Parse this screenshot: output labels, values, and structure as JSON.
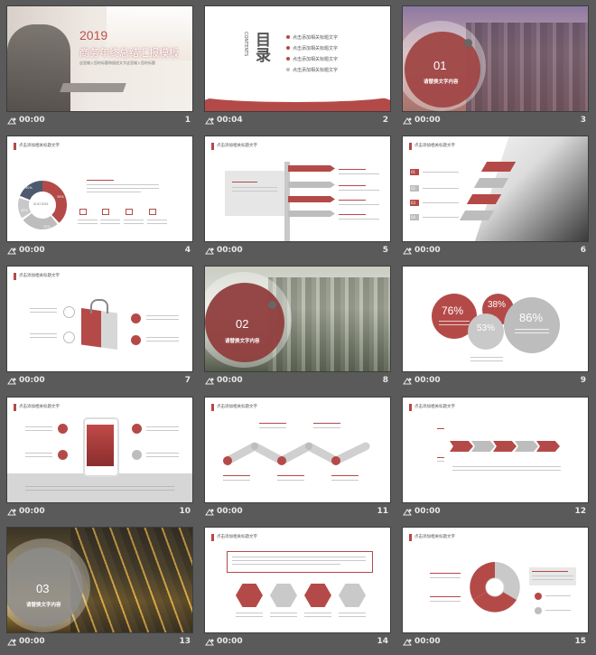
{
  "colors": {
    "accent": "#b44a48",
    "gray": "#bdbdbd",
    "dark": "#5a5a5a",
    "bg": "#5a5a5a"
  },
  "slides": [
    {
      "time": "00:00",
      "number": "1",
      "year": "2019",
      "title": "商务年终总结汇报模板",
      "subtitle": "这里输入您的标题和描述文字这里输入您的标题"
    },
    {
      "time": "00:04",
      "number": "2",
      "heading": "目录",
      "heading_en": "CONTENTS",
      "items": [
        "点击添加相关标题文字",
        "点击添加相关标题文字",
        "点击添加相关标题文字",
        "点击添加相关标题文字"
      ]
    },
    {
      "time": "00:00",
      "number": "3",
      "section_num": "01",
      "section_title": "请替换文字内容"
    },
    {
      "time": "00:00",
      "number": "4",
      "header": "点击添加相关标题文字",
      "center_label": "SUCCESS",
      "pct_a": "35%",
      "pct_b": "25%",
      "pct_c": "40%",
      "pct_d": "30%"
    },
    {
      "time": "00:00",
      "number": "5",
      "header": "点击添加相关标题文字"
    },
    {
      "time": "00:00",
      "number": "6",
      "header": "点击添加相关标题文字",
      "items": [
        "01",
        "02",
        "03",
        "04"
      ]
    },
    {
      "time": "00:00",
      "number": "7",
      "header": "点击添加相关标题文字"
    },
    {
      "time": "00:00",
      "number": "8",
      "section_num": "02",
      "section_title": "请替换文字内容"
    },
    {
      "time": "00:00",
      "number": "9",
      "stats": [
        "76%",
        "38%",
        "53%",
        "86%"
      ]
    },
    {
      "time": "00:00",
      "number": "10",
      "header": "点击添加相关标题文字"
    },
    {
      "time": "00:00",
      "number": "11",
      "header": "点击添加相关标题文字"
    },
    {
      "time": "00:00",
      "number": "12",
      "header": "点击添加相关标题文字"
    },
    {
      "time": "00:00",
      "number": "13",
      "section_num": "03",
      "section_title": "请替换文字内容"
    },
    {
      "time": "00:00",
      "number": "14",
      "header": "点击添加相关标题文字"
    },
    {
      "time": "00:00",
      "number": "15",
      "header": "点击添加相关标题文字"
    }
  ]
}
